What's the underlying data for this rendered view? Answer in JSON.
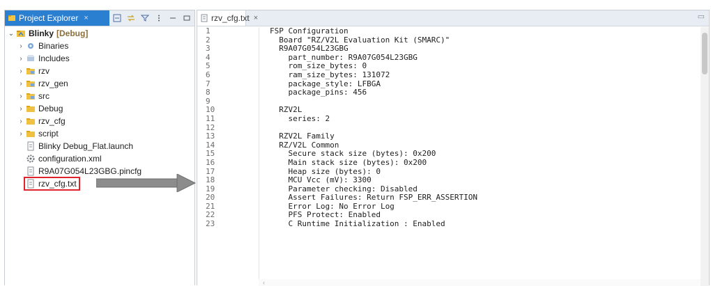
{
  "project_explorer": {
    "tab_label": "Project Explorer",
    "close_glyph": "×",
    "toolbar": [
      {
        "name": "collapse-all-icon",
        "glyph": "⊟"
      },
      {
        "name": "link-editor-icon",
        "glyph": "⇆"
      },
      {
        "name": "filter-icon",
        "glyph": "▽"
      },
      {
        "name": "view-menu-icon",
        "glyph": "⋮"
      },
      {
        "name": "minimize-icon",
        "glyph": "▭"
      },
      {
        "name": "maximize-icon",
        "glyph": "□"
      }
    ],
    "project": {
      "name": "Blinky",
      "tag": "[Debug]"
    },
    "items": [
      {
        "label": "Binaries",
        "icon": "binaries-icon",
        "expandable": true
      },
      {
        "label": "Includes",
        "icon": "includes-icon",
        "expandable": true
      },
      {
        "label": "rzv",
        "icon": "folder-icon",
        "expandable": true
      },
      {
        "label": "rzv_gen",
        "icon": "folder-icon",
        "expandable": true
      },
      {
        "label": "src",
        "icon": "folder-icon",
        "expandable": true
      },
      {
        "label": "Debug",
        "icon": "folder-icon",
        "expandable": true
      },
      {
        "label": "rzv_cfg",
        "icon": "folder-icon",
        "expandable": true
      },
      {
        "label": "script",
        "icon": "folder-icon",
        "expandable": true
      },
      {
        "label": "Blinky Debug_Flat.launch",
        "icon": "file-icon",
        "expandable": false
      },
      {
        "label": "configuration.xml",
        "icon": "gear-icon",
        "expandable": false
      },
      {
        "label": "R9A07G054L23GBG.pincfg",
        "icon": "file-icon",
        "expandable": false
      },
      {
        "label": "rzv_cfg.txt",
        "icon": "file-icon",
        "expandable": false,
        "highlighted": true
      }
    ]
  },
  "editor": {
    "tab_label": "rzv_cfg.txt",
    "close_glyph": "×",
    "lines": [
      "FSP Configuration",
      "  Board \"RZ/V2L Evaluation Kit (SMARC)\"",
      "  R9A07G054L23GBG",
      "    part_number: R9A07G054L23GBG",
      "    rom_size_bytes: 0",
      "    ram_size_bytes: 131072",
      "    package_style: LFBGA",
      "    package_pins: 456",
      "",
      "  RZV2L",
      "    series: 2",
      "",
      "  RZV2L Family",
      "  RZ/V2L Common",
      "    Secure stack size (bytes): 0x200",
      "    Main stack size (bytes): 0x200",
      "    Heap size (bytes): 0",
      "    MCU Vcc (mV): 3300",
      "    Parameter checking: Disabled",
      "    Assert Failures: Return FSP_ERR_ASSERTION",
      "    Error Log: No Error Log",
      "    PFS Protect: Enabled",
      "    C Runtime Initialization : Enabled"
    ],
    "line_numbers": [
      "1",
      "2",
      "3",
      "4",
      "5",
      "6",
      "7",
      "8",
      "9",
      "10",
      "11",
      "12",
      "13",
      "14",
      "15",
      "16",
      "17",
      "18",
      "19",
      "20",
      "21",
      "22",
      "23"
    ]
  },
  "colors": {
    "accent": "#2b7fd0",
    "highlight": "#e0232b",
    "arrow": "#8c8c8c"
  }
}
